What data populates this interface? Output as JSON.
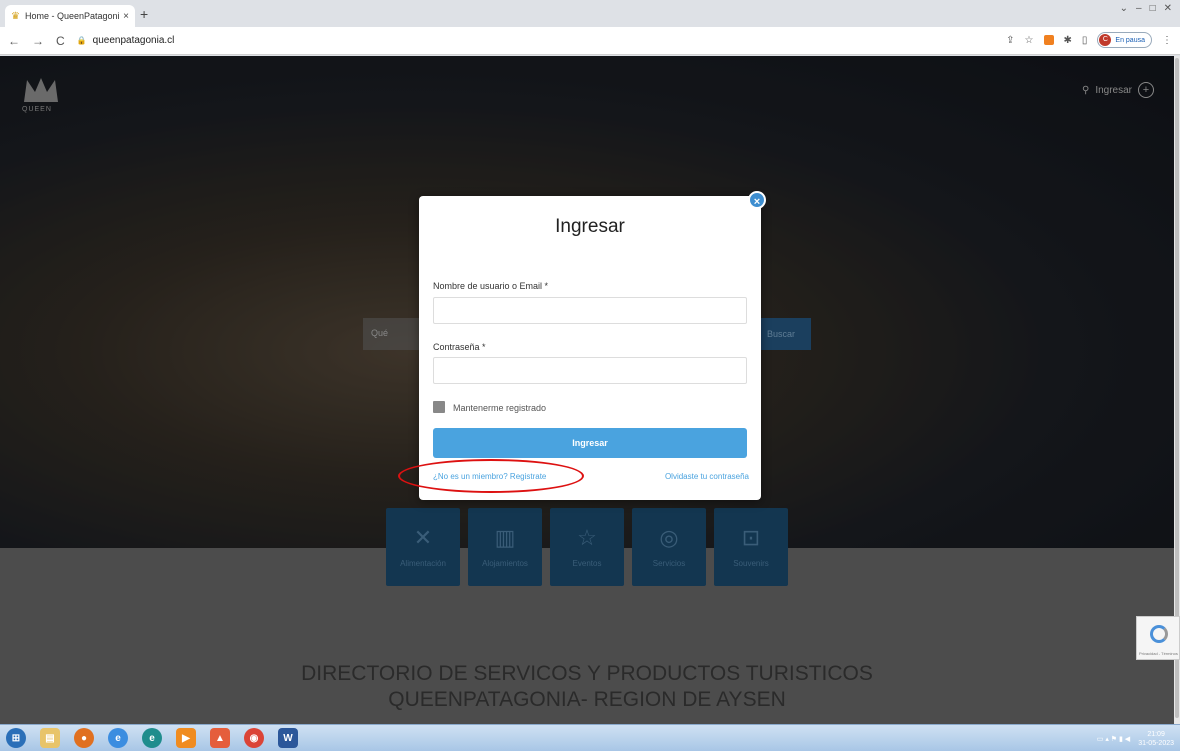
{
  "browser": {
    "tab_title": "Home - QueenPatagonia",
    "tab_close": "×",
    "new_tab": "+",
    "url": "queenpatagonia.cl",
    "profile_initial": "C",
    "profile_status": "En pausa"
  },
  "site": {
    "logo_text": "QUEEN",
    "login_link": "Ingresar",
    "search_label": "Qué",
    "search_button": "Buscar",
    "categories": [
      {
        "label": "Alimentación",
        "icon": "fork-knife-icon"
      },
      {
        "label": "Alojamientos",
        "icon": "building-icon"
      },
      {
        "label": "Eventos",
        "icon": "star-icon"
      },
      {
        "label": "Servicios",
        "icon": "gear-icon"
      },
      {
        "label": "Souvenirs",
        "icon": "gift-icon"
      }
    ],
    "title_line1": "DIRECTORIO DE SERVICOS Y PRODUCTOS TURISTICOS",
    "title_line2": "QUEENPATAGONIA- REGION DE AYSEN",
    "recaptcha_text": "Privacidad - Términos"
  },
  "modal": {
    "title": "Ingresar",
    "username_label": "Nombre de usuario o Email *",
    "username_value": "",
    "password_label": "Contraseña *",
    "password_value": "",
    "remember_label": "Mantenerme registrado",
    "submit_label": "Ingresar",
    "register_link": "¿No es un miembro? Registrate",
    "forgot_link": "Olvidaste tu contraseña",
    "close_label": "×"
  },
  "taskbar": {
    "time": "21:09",
    "date": "31-05-2023"
  },
  "colors": {
    "accent": "#4aa3df",
    "highlight_ellipse": "#dd1111"
  }
}
